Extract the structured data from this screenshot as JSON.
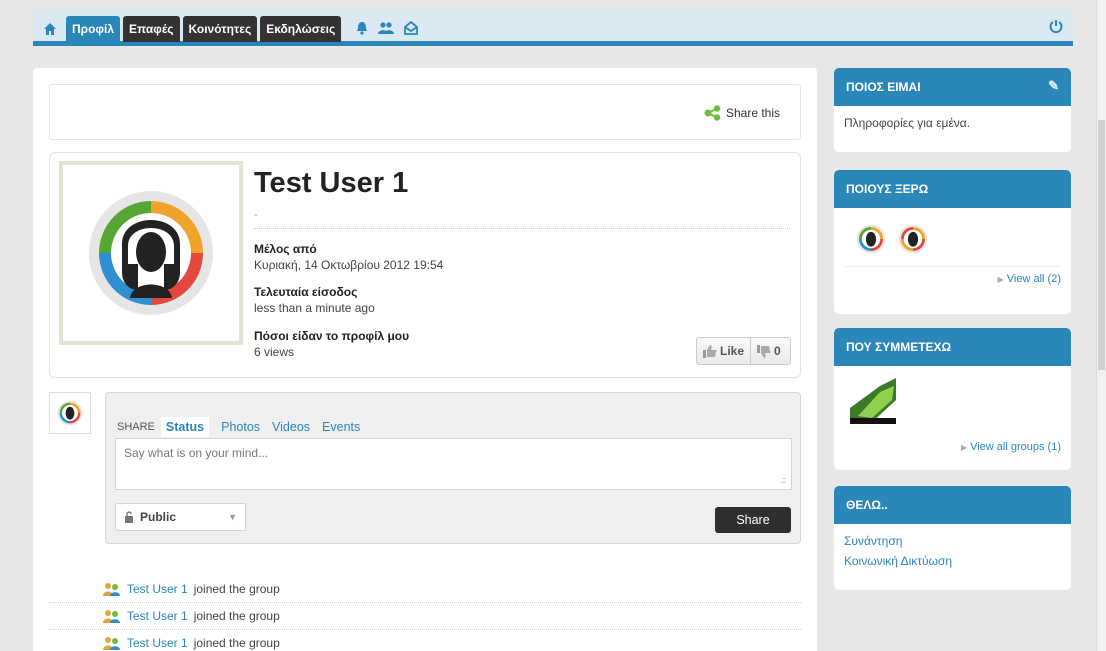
{
  "nav": {
    "tabs": [
      {
        "label": "Προφίλ",
        "active": true
      },
      {
        "label": "Επαφές",
        "active": false
      },
      {
        "label": "Κοινότητες",
        "active": false
      },
      {
        "label": "Εκδηλώσεις",
        "active": false
      }
    ],
    "icons": [
      "home-icon",
      "bell-icon",
      "friends-icon",
      "inbox-icon",
      "power-icon"
    ]
  },
  "share_this": {
    "label": "Share this"
  },
  "profile": {
    "name": "Test User 1",
    "status": "-",
    "member_since_label": "Μέλος από",
    "member_since_value": "Κυριακή, 14 Οκτωβρίου 2012 19:54",
    "last_login_label": "Τελευταία είσοδος",
    "last_login_value": "less than a minute ago",
    "views_label": "Πόσοι είδαν το προφίλ μου",
    "views_value": "6 views",
    "like_label": "Like",
    "dislike_count": "0"
  },
  "composer": {
    "share_label": "SHARE",
    "tabs": [
      "Status",
      "Photos",
      "Videos",
      "Events"
    ],
    "placeholder": "Say what is on your mind...",
    "privacy": "Public",
    "submit": "Share"
  },
  "activity": [
    {
      "user": "Test User 1",
      "action": "joined the group"
    },
    {
      "user": "Test User 1",
      "action": "joined the group"
    },
    {
      "user": "Test User 1",
      "action": "joined the group"
    }
  ],
  "sidebar": {
    "about": {
      "title": "ΠΟΙΟΣ ΕΙΜΑΙ",
      "text": "Πληροφορίες για εμένα."
    },
    "friends": {
      "title": "ΠΟΙΟΥΣ ΞΕΡΩ",
      "view_all": "View all (2)"
    },
    "groups": {
      "title": "ΠΟΥ ΣΥΜΜΕΤΕΧΩ",
      "view_all": "View all groups (1)"
    },
    "wants": {
      "title": "ΘΕΛΩ..",
      "links": [
        "Συνάντηση",
        "Κοινωνική Δικτύωση"
      ]
    }
  },
  "colors": {
    "accent": "#2b86b9",
    "dark_tab": "#333333",
    "nav_bg": "#dbe9f3"
  }
}
